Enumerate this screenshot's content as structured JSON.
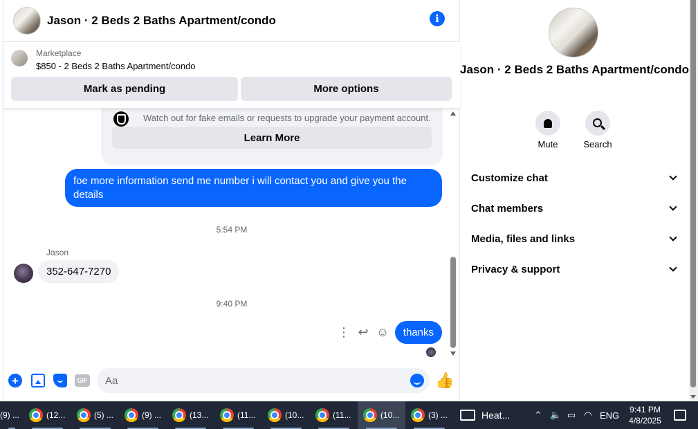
{
  "chat": {
    "title": "Jason · 2 Beds 2 Baths Apartment/condo",
    "listing": {
      "source": "Marketplace",
      "name": "$850 - 2 Beds 2 Baths Apartment/condo"
    },
    "buttons": {
      "mark_pending": "Mark as pending",
      "more_options": "More options"
    },
    "scam_notice": {
      "text": "Watch out for fake emails or requests to upgrade your payment account.",
      "learn_more": "Learn More"
    },
    "messages": [
      {
        "direction": "outgoing",
        "text": "foe more information send me number i will contact you and give you the details"
      },
      {
        "type": "timestamp",
        "text": "5:54 PM"
      },
      {
        "direction": "incoming",
        "sender": "Jason",
        "text": "352-647-7270"
      },
      {
        "type": "timestamp",
        "text": "9:40 PM"
      },
      {
        "direction": "outgoing",
        "text": "thanks"
      }
    ],
    "composer": {
      "placeholder": "Aa",
      "gif_label": "GIF"
    }
  },
  "info_panel": {
    "name": "Jason · 2 Beds 2 Baths Apartment/condo",
    "actions": [
      {
        "label": "Mute",
        "icon": "bell-icon"
      },
      {
        "label": "Search",
        "icon": "search-icon"
      }
    ],
    "sections": [
      "Customize chat",
      "Chat members",
      "Media, files and links",
      "Privacy & support"
    ]
  },
  "taskbar": {
    "items": [
      "(9) ...",
      "(12...",
      "(5) ...",
      "(9) ...",
      "(13...",
      "(11...",
      "(10...",
      "(11...",
      "(10...",
      "(3) ..."
    ],
    "active_index": 8,
    "weather": "Heat...",
    "language": "ENG",
    "time": "9:41 PM",
    "date": "4/8/2025"
  },
  "colors": {
    "accent": "#0866ff",
    "bubble_incoming": "#f0f2f5",
    "button_gray": "#e4e6eb",
    "taskbar": "#202837"
  }
}
